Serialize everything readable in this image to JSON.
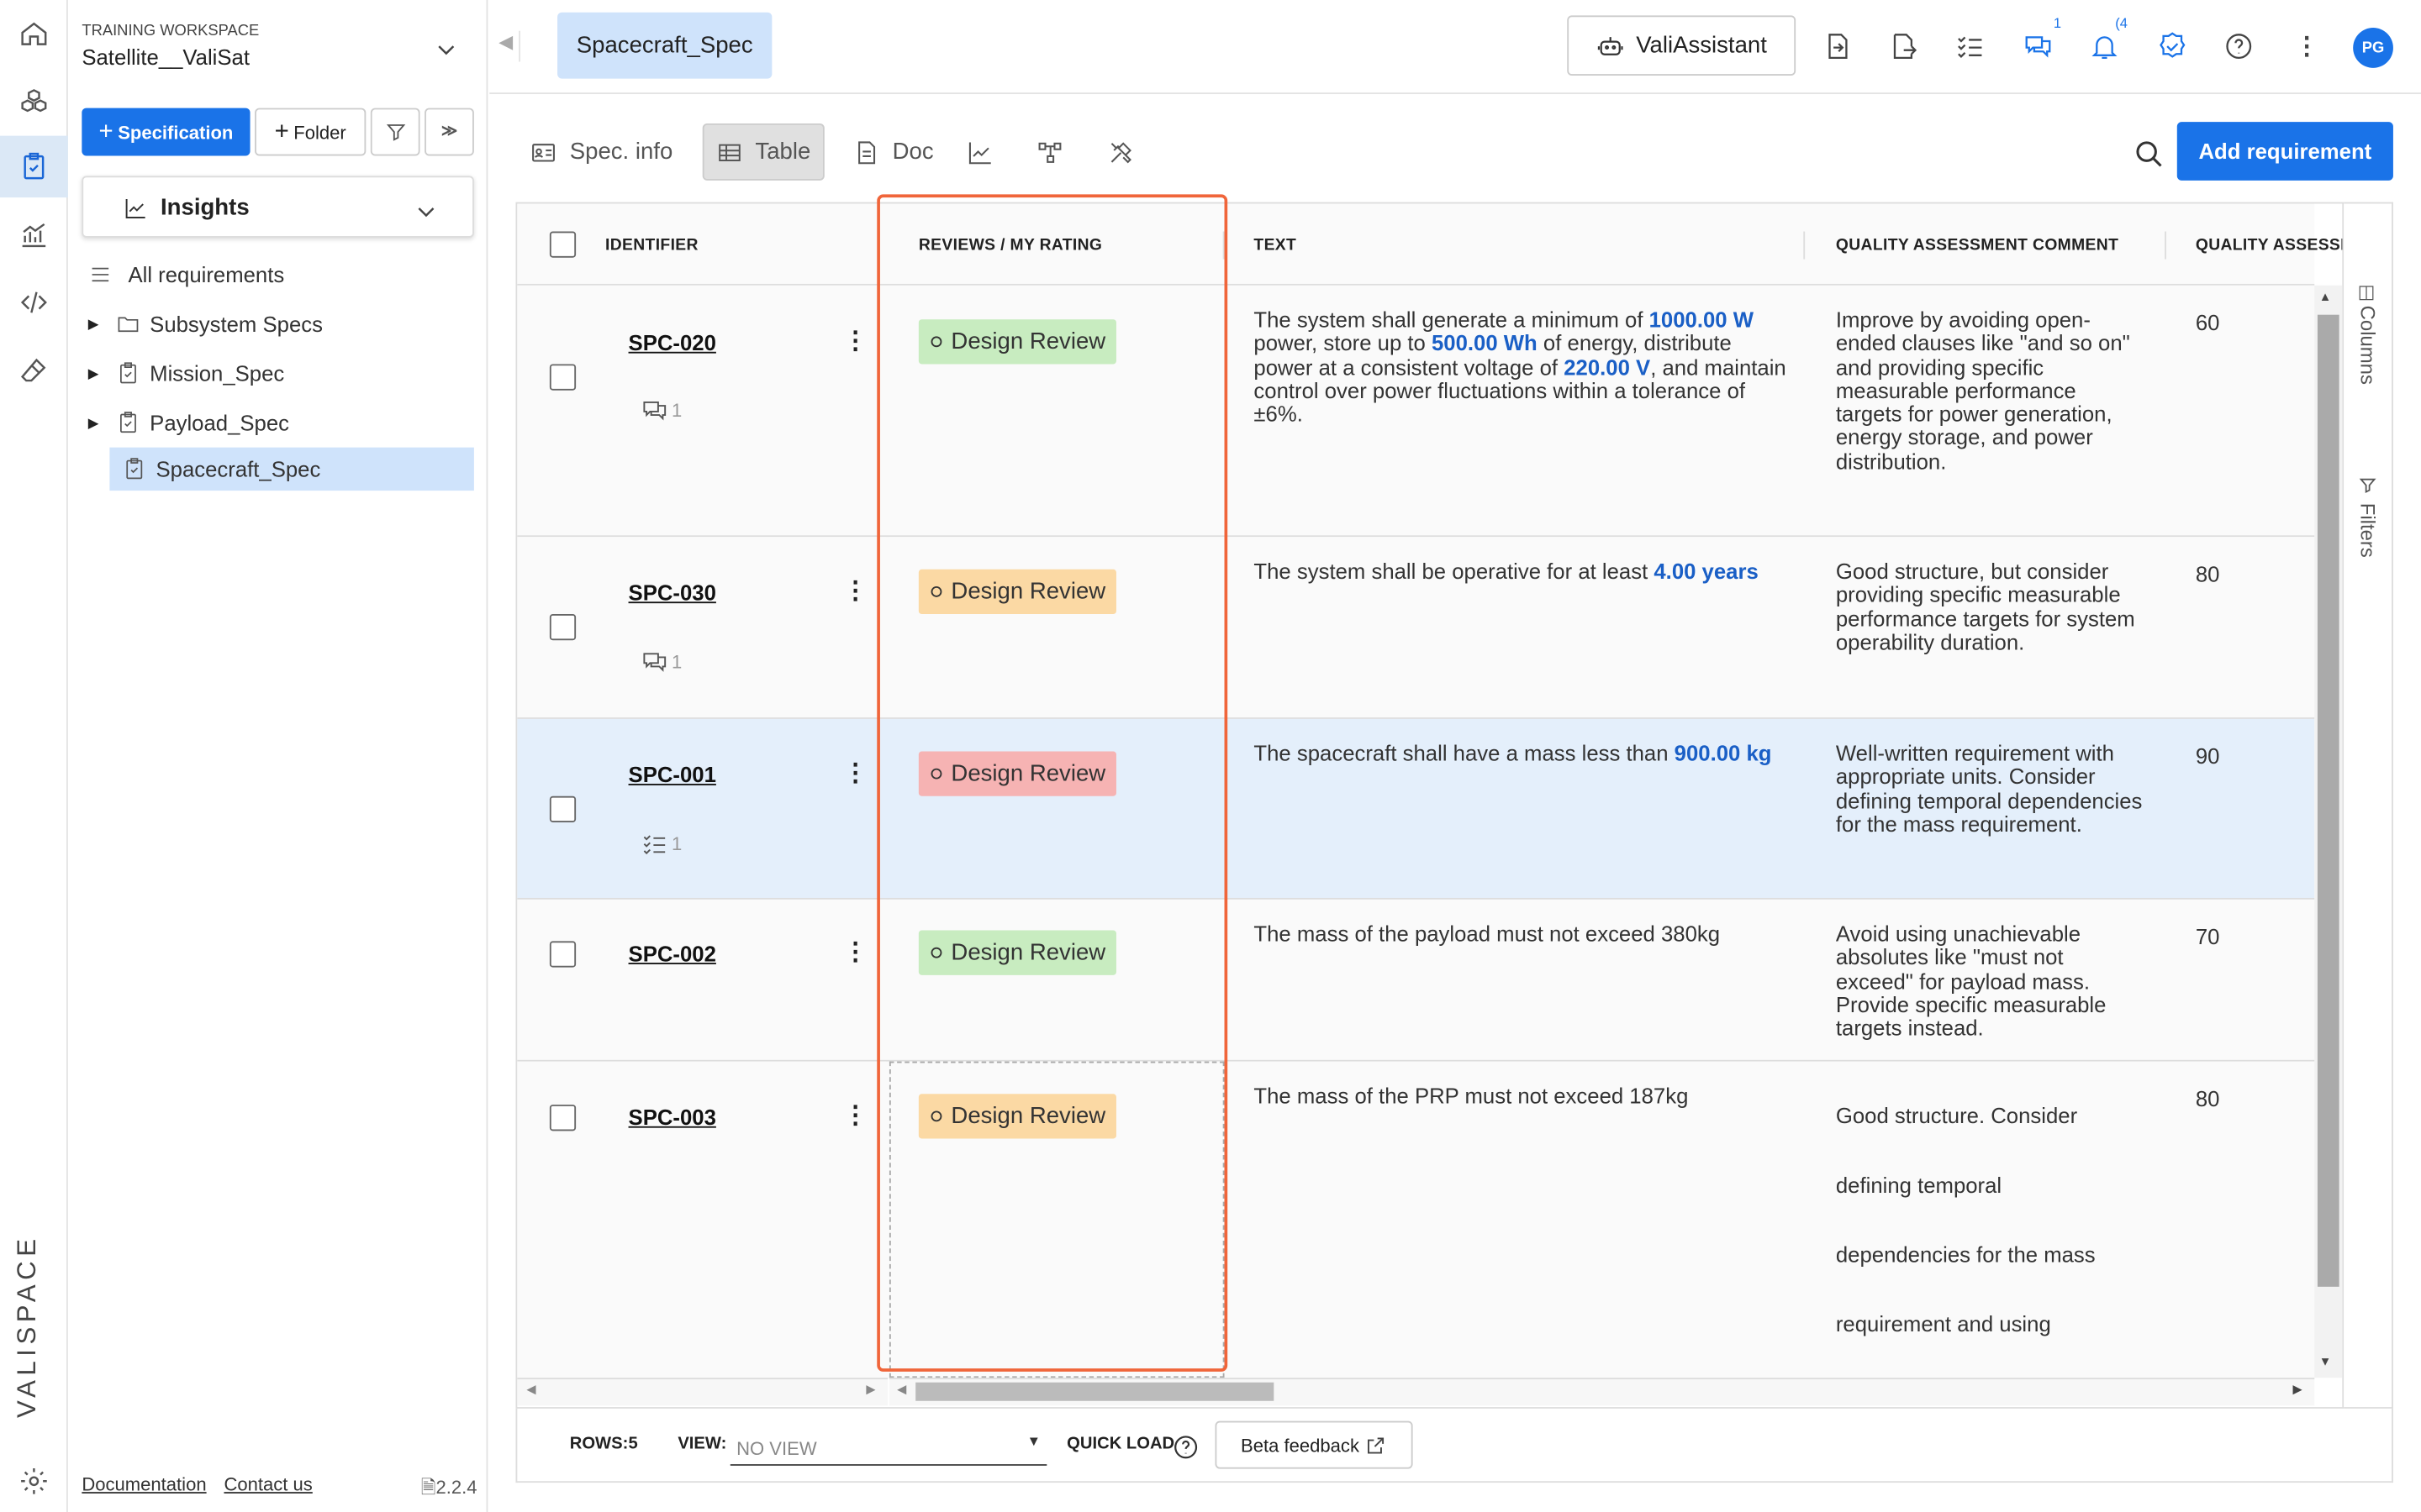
{
  "workspace": {
    "label": "TRAINING WORKSPACE",
    "name": "Satellite__ValiSat"
  },
  "sidebar": {
    "new_spec_label": "Specification",
    "new_folder_label": "Folder",
    "insights_label": "Insights",
    "items": [
      {
        "label": "All requirements"
      },
      {
        "label": "Subsystem Specs"
      },
      {
        "label": "Mission_Spec"
      },
      {
        "label": "Payload_Spec"
      },
      {
        "label": "Spacecraft_Spec"
      }
    ],
    "footer": {
      "documentation": "Documentation",
      "contact": "Contact us",
      "version": "2.2.4"
    }
  },
  "brand": "VALISPACE",
  "topbar": {
    "active_tab": "Spacecraft_Spec",
    "assistant_label": "ValiAssistant",
    "comments_count": "1",
    "notifications_count": "(4",
    "avatar_initials": "PG"
  },
  "toolbar": {
    "spec_info": "Spec. info",
    "table": "Table",
    "doc": "Doc",
    "add_requirement": "Add requirement"
  },
  "table": {
    "columns": {
      "identifier": "IDENTIFIER",
      "reviews": "REVIEWS / MY RATING",
      "text": "TEXT",
      "comment": "QUALITY ASSESSMENT COMMENT",
      "score": "QUALITY ASSESSM"
    },
    "rows": [
      {
        "id": "SPC-020",
        "sub_count": "1",
        "review": "Design Review",
        "text_parts": [
          "The system shall generate a minimum of ",
          "1000.00  W",
          " power, store up to ",
          "500.00  Wh",
          " of energy, distribute power at a consistent voltage of ",
          "220.00  V",
          ", and maintain control over power fluctuations within a tolerance of ±6%."
        ],
        "comment": "Improve by avoiding open-ended clauses like \"and so on\" and providing specific measurable performance targets for power generation, energy storage, and power distribution.",
        "score": "60"
      },
      {
        "id": "SPC-030",
        "sub_count": "1",
        "review": "Design Review",
        "text_parts": [
          "The system shall be operative for at least ",
          "4.00  years"
        ],
        "comment": "Good structure, but consider providing specific measurable performance targets for system operability duration.",
        "score": "80"
      },
      {
        "id": "SPC-001",
        "sub_count": "1",
        "review": "Design Review",
        "text_parts": [
          "The spacecraft shall have a mass less than ",
          "900.00  kg"
        ],
        "comment": "Well-written requirement with appropriate units. Consider defining temporal dependencies for the mass requirement.",
        "score": "90"
      },
      {
        "id": "SPC-002",
        "review": "Design Review",
        "text": "The mass of the payload must not exceed 380kg",
        "comment": "Avoid using unachievable absolutes like \"must not exceed\" for payload mass. Provide specific measurable targets instead.",
        "score": "70"
      },
      {
        "id": "SPC-003",
        "review": "Design Review",
        "text": "The mass of the PRP must not exceed 187kg",
        "comment_lines": [
          "Good structure. Consider",
          "defining temporal",
          "dependencies for the mass",
          "requirement and using"
        ],
        "score": "80"
      }
    ]
  },
  "side_panel": {
    "columns": "Columns",
    "filters": "Filters"
  },
  "footer": {
    "rows_label": "ROWS:",
    "rows_value": "5",
    "view_label": "VIEW:",
    "view_placeholder": "NO VIEW",
    "quick_load": "QUICK LOAD",
    "beta_feedback": "Beta feedback"
  }
}
